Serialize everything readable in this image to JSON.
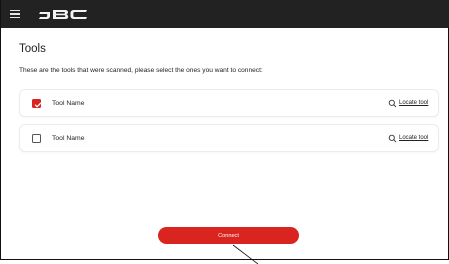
{
  "app": {
    "brand": "JBC",
    "menu_icon": "hamburger-menu-icon",
    "colors": {
      "topbar": "#222222",
      "accent": "#d9241f"
    }
  },
  "page": {
    "title": "Tools",
    "subtitle": "These are the tools that were scanned, please select the ones you want to connect:"
  },
  "tools": [
    {
      "name": "Tool Name",
      "checked": true,
      "locate_label": "Locate tool",
      "locate_icon": "search-icon"
    },
    {
      "name": "Tool Name",
      "checked": false,
      "locate_label": "Locate tool",
      "locate_icon": "search-icon"
    }
  ],
  "footer": {
    "connect_label": "Connect"
  }
}
